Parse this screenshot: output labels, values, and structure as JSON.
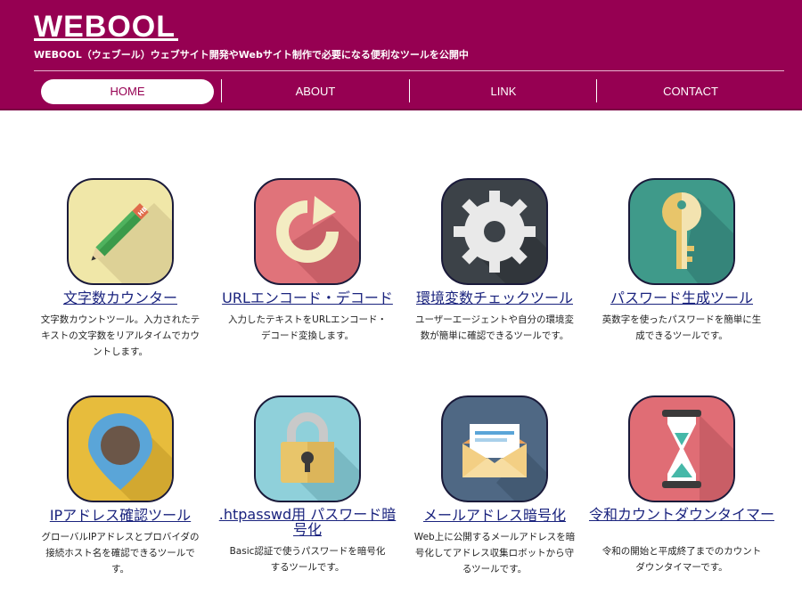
{
  "header": {
    "logo": "WEBOOL",
    "tagline": "WEBOOL（ウェブール）ウェブサイト開発やWebサイト制作で必要になる便利なツールを公開中"
  },
  "nav": [
    {
      "label": "HOME",
      "active": true
    },
    {
      "label": "ABOUT"
    },
    {
      "label": "LINK"
    },
    {
      "label": "CONTACT"
    }
  ],
  "tools": [
    {
      "title": "文字数カウンター",
      "desc": "文字数カウントツール。入力されたテキストの文字数をリアルタイムでカウントします。",
      "icon": "pencil-icon",
      "color": "#f0e7a8"
    },
    {
      "title": "URLエンコード・デコード",
      "desc": "入力したテキストをURLエンコード・デコード変換します。",
      "icon": "refresh-arrow-icon",
      "color": "#e0737a"
    },
    {
      "title": "環境変数チェックツール",
      "desc": "ユーザーエージェントや自分の環境変数が簡単に確認できるツールです。",
      "icon": "gear-icon",
      "color": "#3c4248"
    },
    {
      "title": "パスワード生成ツール",
      "desc": "英数字を使ったパスワードを簡単に生成できるツールです。",
      "icon": "key-icon",
      "color": "#3f9a8a"
    },
    {
      "title": "IPアドレス確認ツール",
      "desc": "グローバルIPアドレスとプロバイダの接続ホスト名を確認できるツールです。",
      "icon": "map-pin-icon",
      "color": "#e7bc3c"
    },
    {
      "title": ".htpasswd用 パスワード暗号化",
      "desc": "Basic認証で使うパスワードを暗号化するツールです。",
      "icon": "padlock-icon",
      "color": "#8fd0da"
    },
    {
      "title": "メールアドレス暗号化",
      "desc": "Web上に公開するメールアドレスを暗号化してアドレス収集ロボットから守るツールです。",
      "icon": "envelope-icon",
      "color": "#4f6884"
    },
    {
      "title": "令和カウントダウンタイマー",
      "desc": "令和の開始と平成終了までのカウントダウンタイマーです。",
      "icon": "hourglass-icon",
      "color": "#e06d75"
    }
  ]
}
